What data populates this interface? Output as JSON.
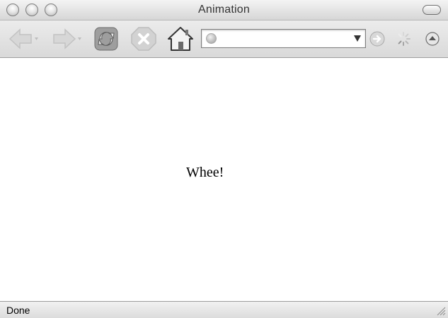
{
  "window": {
    "title": "Animation"
  },
  "toolbar": {
    "icons": {
      "back": "back-arrow-icon",
      "forward": "forward-arrow-icon",
      "reload": "reload-icon",
      "stop": "stop-icon",
      "home": "home-icon",
      "go": "go-icon",
      "throbber": "loading-throbber-icon",
      "sidebar": "sidebar-toggle-icon"
    },
    "url": {
      "value": "",
      "placeholder": ""
    }
  },
  "content": {
    "text": "Whee!"
  },
  "status": {
    "text": "Done"
  },
  "colors": {
    "chrome_light": "#f4f4f4",
    "chrome_dark": "#d6d6d6",
    "icon_gray": "#bdbdbd",
    "content_bg": "#ffffff"
  }
}
